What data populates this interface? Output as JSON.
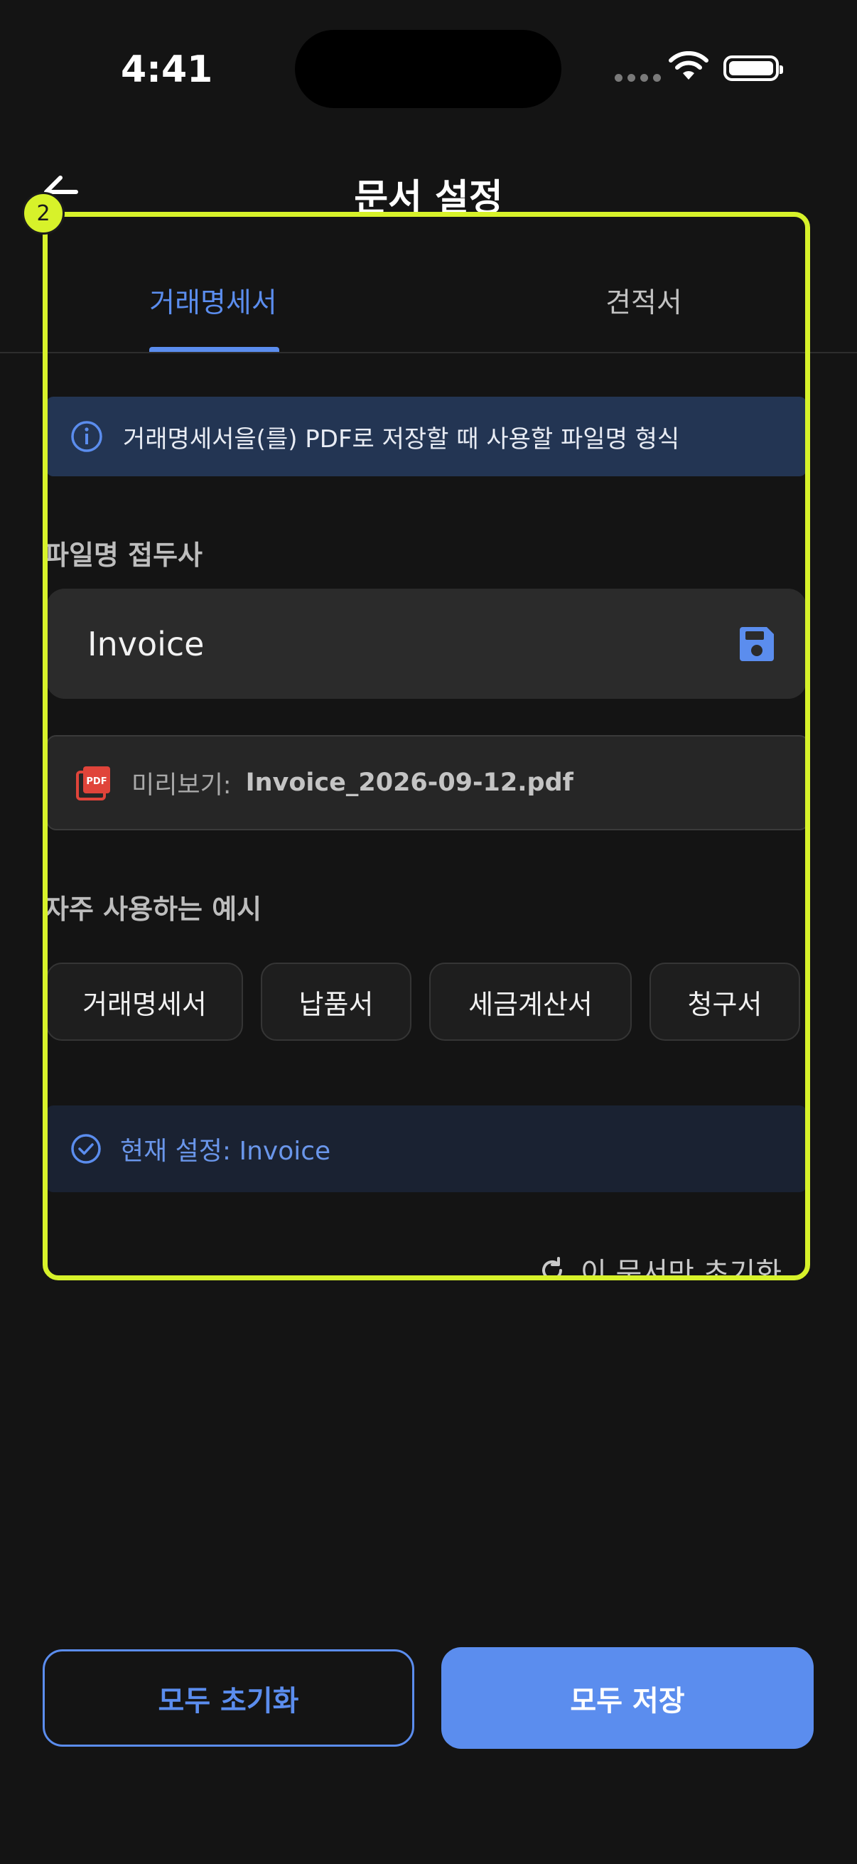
{
  "status_bar": {
    "time": "4:41"
  },
  "header": {
    "title": "문서 설정"
  },
  "tabs": [
    {
      "label": "거래명세서"
    },
    {
      "label": "견적서"
    }
  ],
  "info_banner": {
    "text": "거래명세서을(를) PDF로 저장할 때 사용할 파일명 형식"
  },
  "filename_section": {
    "label": "파일명 접두사",
    "value": "Invoice",
    "save_icon": "floppy-disk-icon"
  },
  "preview": {
    "label": "미리보기:",
    "filename": "Invoice_2026-09-12.pdf",
    "icon": "pdf-icon"
  },
  "examples": {
    "label": "자주 사용하는 예시",
    "chips": [
      "거래명세서",
      "납품서",
      "세금계산서",
      "청구서"
    ]
  },
  "current_setting": {
    "text": "현재 설정: Invoice"
  },
  "reset_this": {
    "label": "이 문서만 초기화"
  },
  "highlight": {
    "badge": "2",
    "color": "#d7f22a"
  },
  "bottom": {
    "reset_all_label": "모두 초기화",
    "save_all_label": "모두 저장"
  },
  "colors": {
    "accent": "#5b8dee",
    "background": "#141414",
    "surface": "#2b2b2b"
  }
}
